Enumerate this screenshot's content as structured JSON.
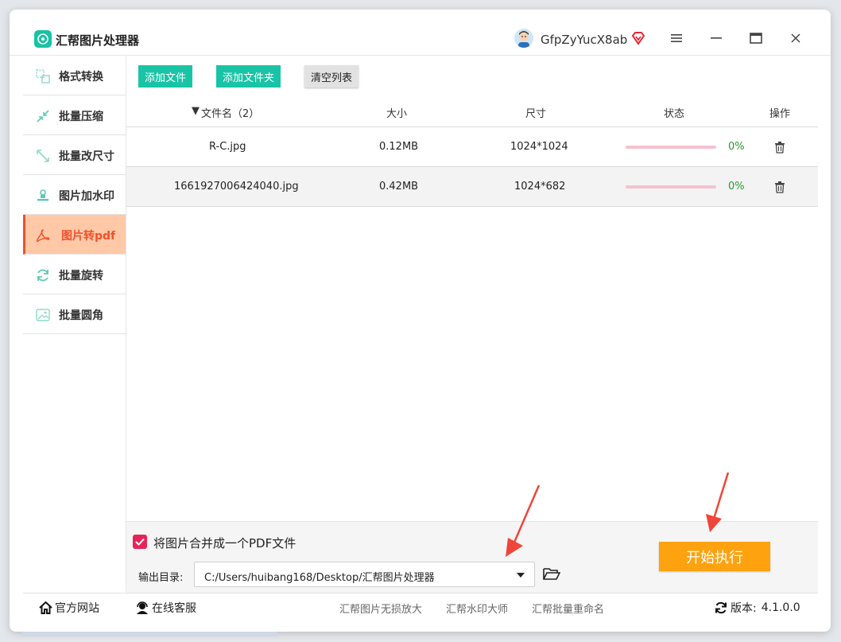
{
  "app": {
    "title": "汇帮图片处理器",
    "username": "GfpZyYucX8ab"
  },
  "sidebar": {
    "items": [
      {
        "label": "格式转换",
        "icon": "format-convert-icon"
      },
      {
        "label": "批量压缩",
        "icon": "compress-icon"
      },
      {
        "label": "批量改尺寸",
        "icon": "resize-icon"
      },
      {
        "label": "图片加水印",
        "icon": "watermark-icon"
      },
      {
        "label": "图片转pdf",
        "icon": "pdf-icon",
        "active": true
      },
      {
        "label": "批量旋转",
        "icon": "rotate-icon"
      },
      {
        "label": "批量圆角",
        "icon": "rounded-corner-icon"
      }
    ]
  },
  "toolbar": {
    "add_file": "添加文件",
    "add_folder": "添加文件夹",
    "clear_list": "清空列表"
  },
  "table": {
    "headers": {
      "name": "文件名（2）",
      "size": "大小",
      "dimensions": "尺寸",
      "status": "状态",
      "action": "操作"
    },
    "rows": [
      {
        "name": "R-C.jpg",
        "size": "0.12MB",
        "dimensions": "1024*1024",
        "status": "0%",
        "progress": 0
      },
      {
        "name": "1661927006424040.jpg",
        "size": "0.42MB",
        "dimensions": "1024*682",
        "status": "0%",
        "progress": 0
      }
    ]
  },
  "options": {
    "merge_label": "将图片合并成一个PDF文件",
    "merge_checked": true,
    "output_label": "输出目录:",
    "output_path": "C:/Users/huibang168/Desktop/汇帮图片处理器"
  },
  "actions": {
    "start": "开始执行"
  },
  "footer": {
    "website": "官方网站",
    "support": "在线客服",
    "links": [
      "汇帮图片无损放大",
      "汇帮水印大师",
      "汇帮批量重命名"
    ],
    "version_label": "版本:",
    "version": "4.1.0.0"
  },
  "colors": {
    "accent": "#19c4a6",
    "active_bg": "#ffc9a8",
    "active_text": "#f0512a",
    "start_button": "#ffa20f",
    "arrow": "#f0453a"
  }
}
